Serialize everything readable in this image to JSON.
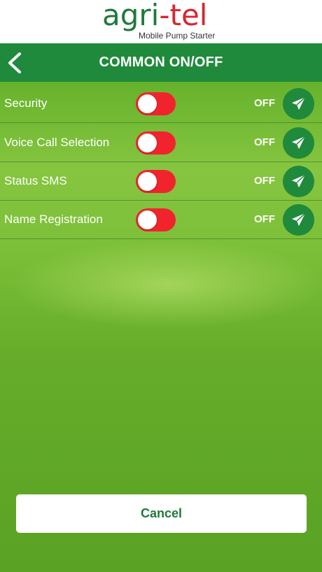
{
  "logo": {
    "word_a": "agri",
    "word_b": "-tel",
    "tagline": "Mobile Pump Starter"
  },
  "header": {
    "title": "COMMON ON/OFF",
    "back_icon": "chevron-left-icon"
  },
  "settings": [
    {
      "label": "Security",
      "state": "OFF",
      "toggle_on": false
    },
    {
      "label": "Voice Call Selection",
      "state": "OFF",
      "toggle_on": false
    },
    {
      "label": "Status SMS",
      "state": "OFF",
      "toggle_on": false
    },
    {
      "label": "Name Registration",
      "state": "OFF",
      "toggle_on": false
    }
  ],
  "send_icon": "paper-plane-icon",
  "cancel_label": "Cancel",
  "colors": {
    "brand_green": "#1f8a3b",
    "toggle_off": "#f1232d",
    "logo_red": "#d8262f"
  }
}
